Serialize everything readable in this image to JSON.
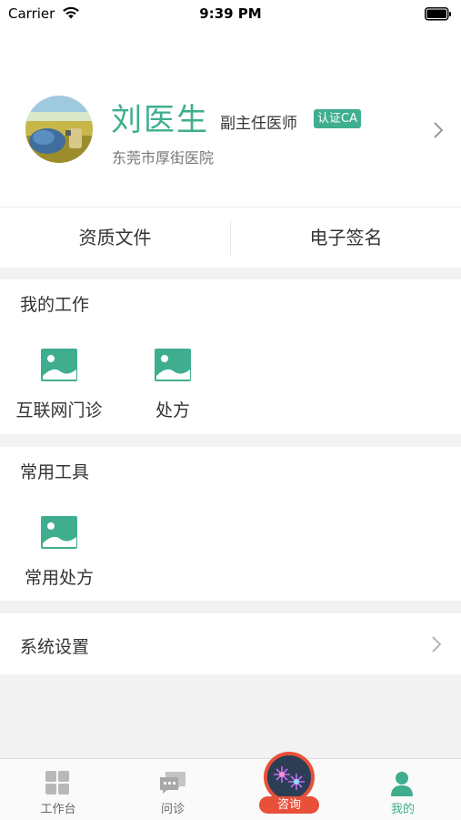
{
  "status_bar": {
    "carrier": "Carrier",
    "time": "9:39 PM",
    "icons": [
      "wifi-icon",
      "battery-icon"
    ]
  },
  "profile": {
    "name": "刘医生",
    "title": "副主任医师",
    "badge": "认证CA",
    "hospital": "东莞市厚街医院",
    "icons": [
      "avatar",
      "chevron-right-icon"
    ]
  },
  "documents": {
    "left": "资质文件",
    "right": "电子签名"
  },
  "my_work": {
    "title": "我的工作",
    "items": [
      {
        "label": "互联网门诊",
        "icon": "image-placeholder-icon"
      },
      {
        "label": "处方",
        "icon": "image-placeholder-icon"
      }
    ]
  },
  "tools": {
    "title": "常用工具",
    "items": [
      {
        "label": "常用处方",
        "icon": "image-placeholder-icon"
      }
    ]
  },
  "settings": {
    "label": "系统设置",
    "icon": "chevron-right-icon"
  },
  "tab_bar": {
    "tabs": [
      {
        "label": "工作台",
        "icon": "grid-icon",
        "active": false
      },
      {
        "label": "问诊",
        "icon": "chat-icon",
        "active": false
      },
      {
        "label": "咨询",
        "icon": "consult-icon",
        "active": false
      },
      {
        "label": "我的",
        "icon": "person-icon",
        "active": true
      }
    ]
  },
  "colors": {
    "accent": "#3fae8f",
    "consult": "#e8503a",
    "background": "#f2f2f2"
  }
}
